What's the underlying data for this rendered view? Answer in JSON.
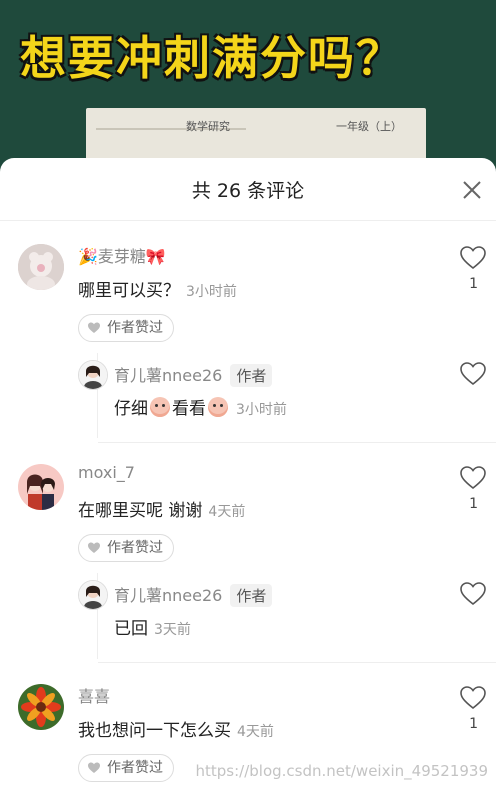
{
  "video": {
    "banner_text": "想要冲刺满分吗？",
    "paper_text_left": "数学研究",
    "paper_text_right": "一年级（上）"
  },
  "sheet": {
    "title": "共 26 条评论"
  },
  "comments": [
    {
      "user": "🎉麦芽糖🎀",
      "text": "哪里可以买？",
      "time": "3小时前",
      "likes": "1",
      "author_liked": "作者赞过",
      "reply": {
        "user": "育儿薯nnee26",
        "author_tag": "作者",
        "text_a": "仔细",
        "text_b": "看看",
        "time": "3小时前"
      }
    },
    {
      "user": "moxi_7",
      "text": "在哪里买呢 谢谢",
      "time": "4天前",
      "likes": "1",
      "author_liked": "作者赞过",
      "reply": {
        "user": "育儿薯nnee26",
        "author_tag": "作者",
        "text": "已回",
        "time": "3天前"
      }
    },
    {
      "user": "喜喜",
      "text": "我也想问一下怎么买",
      "time": "4天前",
      "likes": "1",
      "author_liked": "作者赞过"
    }
  ],
  "watermark": "https://blog.csdn.net/weixin_49521939",
  "colors": {
    "banner_yellow": "#f4d51a",
    "video_green": "#1f4a3c"
  }
}
